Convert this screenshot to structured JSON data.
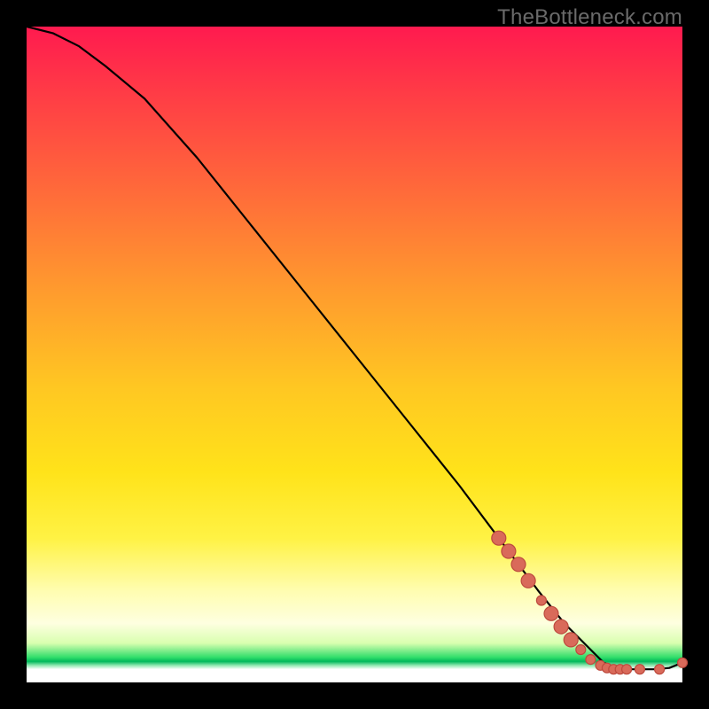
{
  "watermark": "TheBottleneck.com",
  "colors": {
    "dot_fill": "#d96a5a",
    "dot_stroke": "#bd4a3e",
    "line": "#000000"
  },
  "chart_data": {
    "type": "line",
    "title": "",
    "xlabel": "",
    "ylabel": "",
    "xlim": [
      0,
      100
    ],
    "ylim": [
      0,
      100
    ],
    "grid": false,
    "series": [
      {
        "name": "curve",
        "x": [
          0,
          4,
          8,
          12,
          18,
          26,
          34,
          42,
          50,
          58,
          66,
          72,
          78,
          82,
          86,
          88,
          90,
          92,
          94,
          96,
          98,
          100
        ],
        "y": [
          100,
          99,
          97,
          94,
          89,
          80,
          70,
          60,
          50,
          40,
          30,
          22,
          14,
          9,
          5,
          3,
          2.2,
          2.0,
          2.0,
          2.0,
          2.2,
          3
        ]
      }
    ],
    "highlighted_points": {
      "name": "dots",
      "points": [
        {
          "x": 72,
          "y": 22,
          "size": "lg"
        },
        {
          "x": 73.5,
          "y": 20,
          "size": "lg"
        },
        {
          "x": 75,
          "y": 18,
          "size": "lg"
        },
        {
          "x": 76.5,
          "y": 15.5,
          "size": "lg"
        },
        {
          "x": 78.5,
          "y": 12.5,
          "size": "sm"
        },
        {
          "x": 80,
          "y": 10.5,
          "size": "lg"
        },
        {
          "x": 81.5,
          "y": 8.5,
          "size": "lg"
        },
        {
          "x": 83,
          "y": 6.5,
          "size": "lg"
        },
        {
          "x": 84.5,
          "y": 5,
          "size": "sm"
        },
        {
          "x": 86,
          "y": 3.5,
          "size": "sm"
        },
        {
          "x": 87.5,
          "y": 2.6,
          "size": "sm"
        },
        {
          "x": 88.5,
          "y": 2.2,
          "size": "sm"
        },
        {
          "x": 89.5,
          "y": 2.0,
          "size": "sm"
        },
        {
          "x": 90.5,
          "y": 2.0,
          "size": "sm"
        },
        {
          "x": 91.5,
          "y": 2.0,
          "size": "sm"
        },
        {
          "x": 93.5,
          "y": 2.0,
          "size": "sm"
        },
        {
          "x": 96.5,
          "y": 2.0,
          "size": "sm"
        },
        {
          "x": 100,
          "y": 3.0,
          "size": "sm"
        }
      ]
    }
  }
}
